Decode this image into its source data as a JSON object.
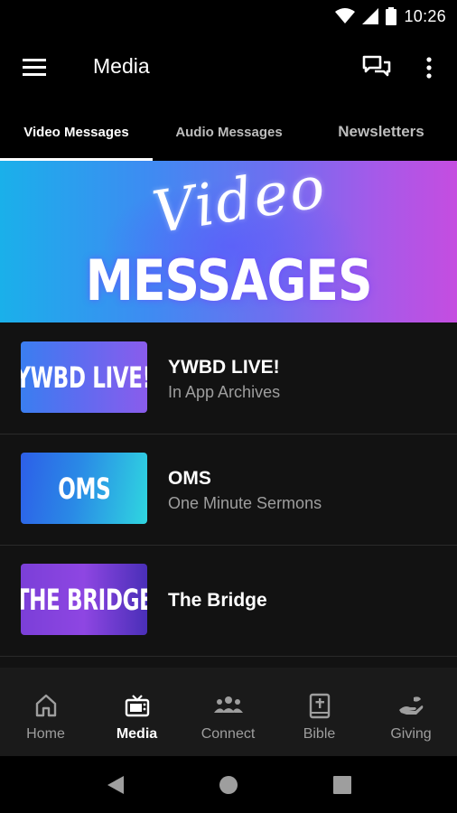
{
  "status_bar": {
    "time": "10:26"
  },
  "app_bar": {
    "title": "Media"
  },
  "tabs": [
    {
      "label": "Video Messages",
      "selected": true
    },
    {
      "label": "Audio Messages",
      "selected": false
    },
    {
      "label": "Newsletters",
      "selected": false
    }
  ],
  "hero": {
    "script_text": "Video",
    "title": "MESSAGES"
  },
  "items": [
    {
      "thumb_text": "YWBD LIVE!",
      "title": "YWBD LIVE!",
      "subtitle": "In App Archives"
    },
    {
      "thumb_text": "OMS",
      "title": "OMS",
      "subtitle": "One Minute Sermons"
    },
    {
      "thumb_text": "THE BRIDGE",
      "title": "The Bridge",
      "subtitle": ""
    }
  ],
  "bottom_nav": [
    {
      "label": "Home",
      "icon": "home-icon",
      "active": false
    },
    {
      "label": "Media",
      "icon": "tv-icon",
      "active": true
    },
    {
      "label": "Connect",
      "icon": "people-icon",
      "active": false
    },
    {
      "label": "Bible",
      "icon": "bible-icon",
      "active": false
    },
    {
      "label": "Giving",
      "icon": "hand-giving-icon",
      "active": false
    }
  ],
  "colors": {
    "background": "#121212",
    "bar": "#000000",
    "nav": "#1a1a1a",
    "muted_text": "#9e9e9e"
  }
}
